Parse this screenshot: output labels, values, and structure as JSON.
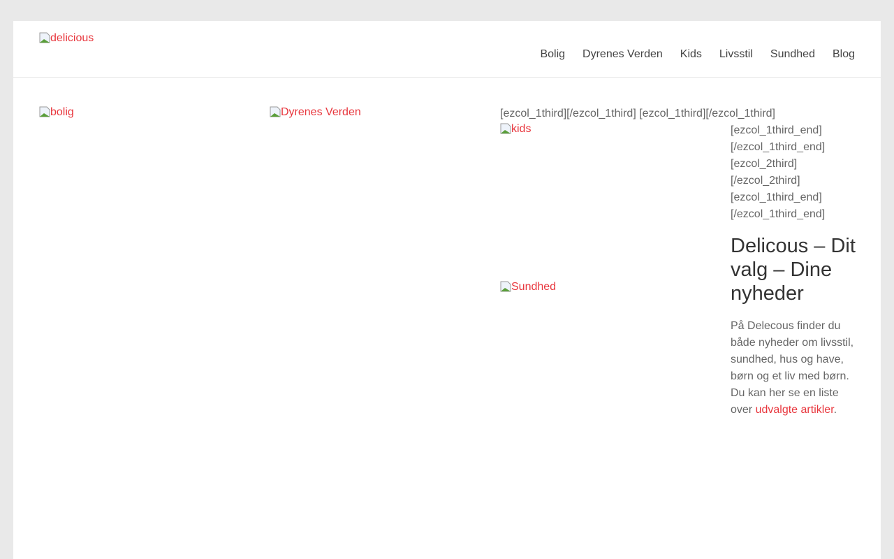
{
  "header": {
    "logo_alt": "delicious",
    "nav": [
      "Bolig",
      "Dyrenes Verden",
      "Kids",
      "Livsstil",
      "Sundhed",
      "Blog"
    ]
  },
  "main": {
    "images": {
      "bolig": "bolig",
      "dyr": "Dyrenes Verden",
      "kids": "kids",
      "sundhed": "Sundhed"
    },
    "shortcode_top": "[ezcol_1third][/ezcol_1third] [ezcol_1third][/ezcol_1third]",
    "shortcodes": [
      "[ezcol_1third_end]",
      "[/ezcol_1third_end]",
      "[ezcol_2third]",
      "[/ezcol_2third]",
      "[ezcol_1third_end]",
      "[/ezcol_1third_end]"
    ],
    "heading": "Delicous – Dit valg – Dine nyheder",
    "intro": "På Delecous finder du både nyheder om livsstil, sundhed, hus og have, børn og et liv med børn. Du kan her se en liste over ",
    "link": "udvalgte artikler",
    "end": "."
  }
}
